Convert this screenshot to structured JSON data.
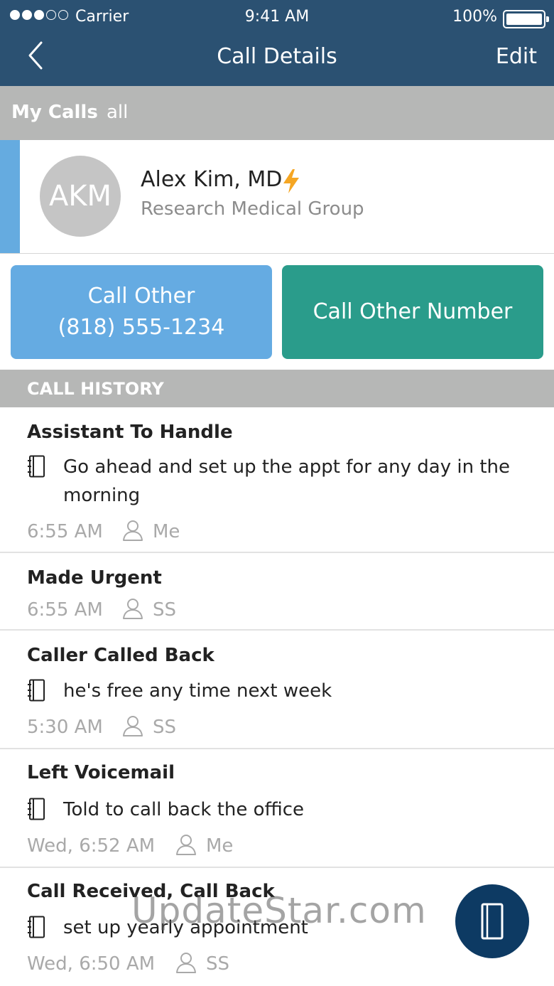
{
  "status_bar": {
    "carrier": "Carrier",
    "time": "9:41 AM",
    "battery": "100%"
  },
  "nav": {
    "title": "Call Details",
    "edit_label": "Edit",
    "back_icon": "chevron-left-icon"
  },
  "subnav": {
    "my_calls": "My Calls",
    "filter": "all"
  },
  "contact": {
    "initials": "AKM",
    "name": "Alex Kim, MD",
    "organization": "Research Medical Group",
    "urgent_icon": "lightning-bolt-icon",
    "accent_color": "#65abe0"
  },
  "actions": {
    "call_other_label": "Call Other",
    "call_other_number": "(818) 555-1234",
    "call_other_number_label": "Call Other Number"
  },
  "history": {
    "header": "CALL HISTORY",
    "entries": [
      {
        "title": "Assistant To Handle",
        "note": "Go ahead and set up the appt for any day in the morning",
        "time": "6:55 AM",
        "who": "Me"
      },
      {
        "title": "Made Urgent",
        "note": "",
        "time": "6:55 AM",
        "who": "SS"
      },
      {
        "title": "Caller Called Back",
        "note": "he's free any time next week",
        "time": "5:30 AM",
        "who": "SS"
      },
      {
        "title": "Left Voicemail",
        "note": "Told to call back the office",
        "time": "Wed, 6:52 AM",
        "who": "Me"
      },
      {
        "title": "Call Received, Call Back",
        "note": "set up yearly appointment",
        "time": "Wed, 6:50 AM",
        "who": "SS"
      }
    ]
  },
  "watermark": "UpdateStar.com",
  "fab_icon": "note-icon",
  "colors": {
    "nav_bar": "#2b5172",
    "sub_bar": "#b6b7b6",
    "call_other_button": "#65abe2",
    "call_other_number_button": "#2a9c8b",
    "urgent": "#f5a623",
    "fab": "#0d3a63"
  }
}
